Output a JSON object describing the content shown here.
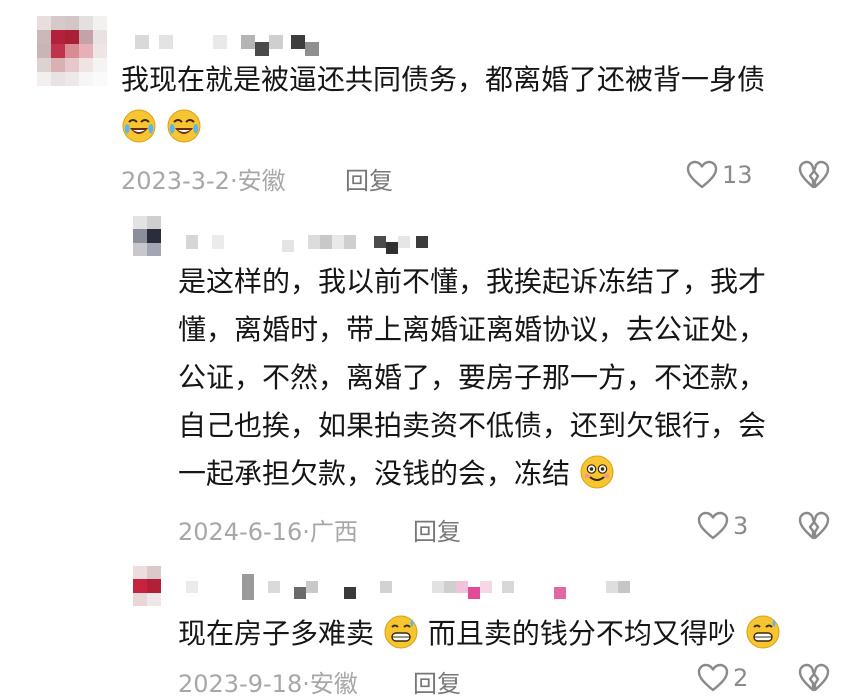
{
  "comments": [
    {
      "text": "我现在就是被逼还共同债务，都离婚了还被背一身债",
      "emojis": [
        "laughing-crying-emoji",
        "laughing-crying-emoji"
      ],
      "date": "2023-3-2",
      "location": "安徽",
      "reply_label": "回复",
      "likes": "13"
    },
    {
      "lines": [
        "是这样的，我以前不懂，我挨起诉冻结了，我才",
        "懂，离婚时，带上离婚证离婚协议，去公证处，",
        "公证，不然，离婚了，要房子那一方，不还款，",
        "自己也挨，如果拍卖资不低债，还到欠银行，会",
        "一起承担欠款，没钱的会，冻结"
      ],
      "emoji": "smiling-emoji",
      "date": "2024-6-16",
      "location": "广西",
      "reply_label": "回复",
      "likes": "3"
    },
    {
      "text_a": "现在房子多难卖",
      "text_b": "而且卖的钱分不均又得吵",
      "emoji": "sweat-grin-emoji",
      "date": "2023-9-18",
      "location": "安徽",
      "reply_label": "回复",
      "likes": "2"
    }
  ],
  "colors": {
    "text": "#161616",
    "meta": "#a7a7a7",
    "reply": "#777777",
    "icon": "#8a8a8a"
  },
  "icons": {
    "like": "heart-outline-icon",
    "dislike": "broken-heart-outline-icon"
  }
}
